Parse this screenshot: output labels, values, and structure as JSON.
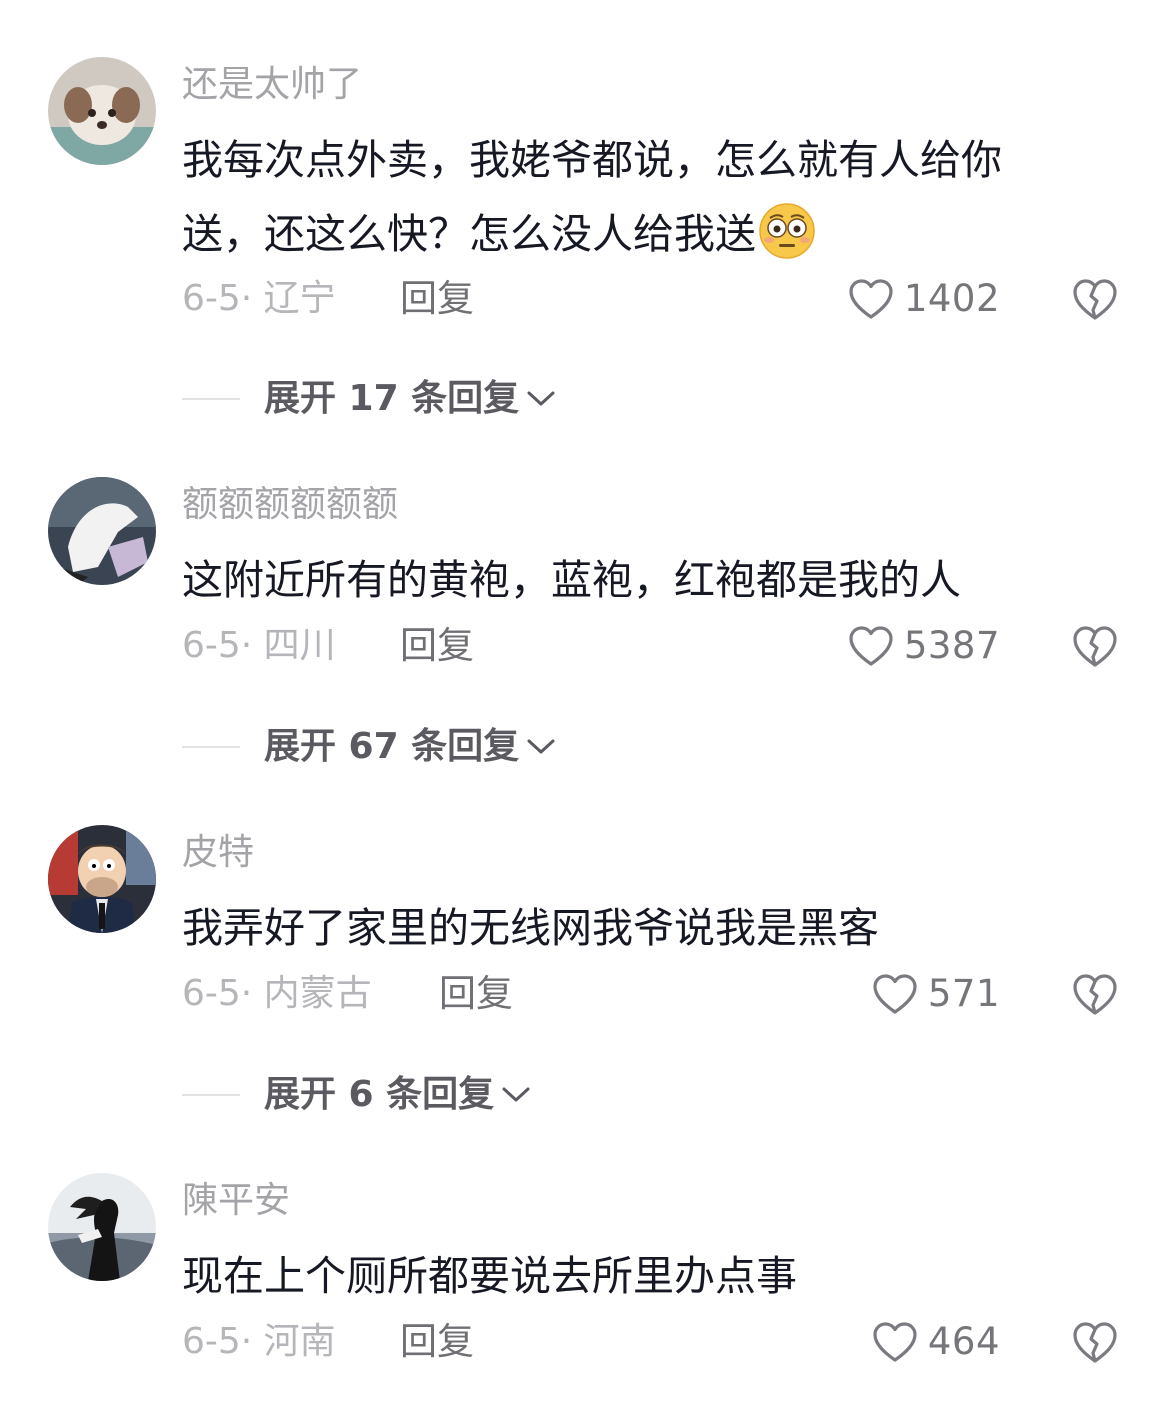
{
  "comments": [
    {
      "username": "还是太帅了",
      "text": "我每次点外卖，我姥爷都说，怎么就有人给你送，还这么快？怎么没人给我送",
      "emoji": "flushed-face-emoji",
      "date_location": "6-5· 辽宁",
      "reply_label": "回复",
      "likes": "1402",
      "expand_label": "展开 17 条回复"
    },
    {
      "username": "额额额额额额",
      "text": "这附近所有的黄袍，蓝袍，红袍都是我的人",
      "date_location": "6-5· 四川",
      "reply_label": "回复",
      "likes": "5387",
      "expand_label": "展开 67 条回复"
    },
    {
      "username": "皮特",
      "text": "我弄好了家里的无线网我爷说我是黑客",
      "date_location": "6-5· 内蒙古",
      "reply_label": "回复",
      "likes": "571",
      "expand_label": "展开 6 条回复"
    },
    {
      "username": "陳平安",
      "text": "现在上个厕所都要说去所里办点事",
      "date_location": "6-5· 河南",
      "reply_label": "回复",
      "likes": "464"
    }
  ],
  "icons": {
    "like": "heart-outline-icon",
    "dislike": "broken-heart-icon",
    "expand": "chevron-down-icon"
  },
  "colors": {
    "text": "#161823",
    "username": "#a4a4a8",
    "meta": "#b6b6ba",
    "reply": "#6f6f74",
    "icon": "#7a7a80"
  }
}
